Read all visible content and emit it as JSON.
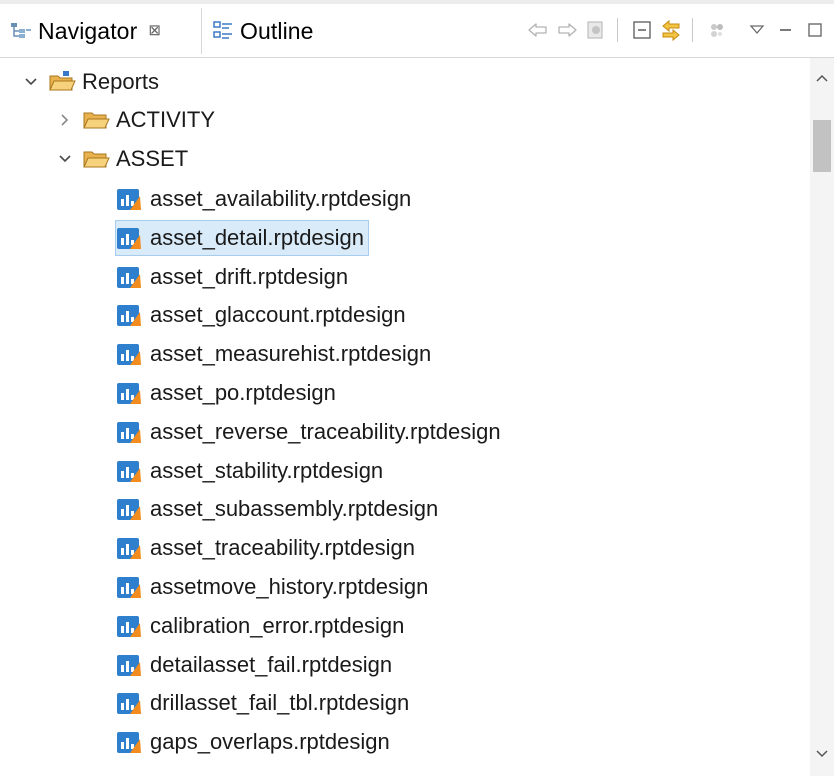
{
  "tabs": [
    {
      "label": "Navigator",
      "close": "⊠",
      "active": true
    },
    {
      "label": "Outline",
      "active": false
    }
  ],
  "toolbar": {
    "icons": [
      "back-arrow-icon",
      "forward-arrow-icon",
      "go-into-icon",
      "collapse-all-icon",
      "link-with-editor-icon",
      "filters-icon",
      "view-menu-icon",
      "minimize-icon",
      "maximize-icon"
    ]
  },
  "tree": {
    "root": {
      "label": "Reports",
      "expanded": true
    },
    "folders": [
      {
        "label": "ACTIVITY",
        "expanded": false
      },
      {
        "label": "ASSET",
        "expanded": true
      }
    ],
    "files": [
      {
        "label": "asset_availability.rptdesign",
        "selected": false
      },
      {
        "label": "asset_detail.rptdesign",
        "selected": true
      },
      {
        "label": "asset_drift.rptdesign",
        "selected": false
      },
      {
        "label": "asset_glaccount.rptdesign",
        "selected": false
      },
      {
        "label": "asset_measurehist.rptdesign",
        "selected": false
      },
      {
        "label": "asset_po.rptdesign",
        "selected": false
      },
      {
        "label": "asset_reverse_traceability.rptdesign",
        "selected": false
      },
      {
        "label": "asset_stability.rptdesign",
        "selected": false
      },
      {
        "label": "asset_subassembly.rptdesign",
        "selected": false
      },
      {
        "label": "asset_traceability.rptdesign",
        "selected": false
      },
      {
        "label": "assetmove_history.rptdesign",
        "selected": false
      },
      {
        "label": "calibration_error.rptdesign",
        "selected": false
      },
      {
        "label": "detailasset_fail.rptdesign",
        "selected": false
      },
      {
        "label": "drillasset_fail_tbl.rptdesign",
        "selected": false
      },
      {
        "label": "gaps_overlaps.rptdesign",
        "selected": false
      }
    ]
  },
  "colors": {
    "selection_bg": "#d9ebf9",
    "selection_border": "#a6cdee",
    "folder": "#e8b04a",
    "report_icon_blue": "#2f7fcf",
    "report_icon_orange": "#f28c1e"
  }
}
